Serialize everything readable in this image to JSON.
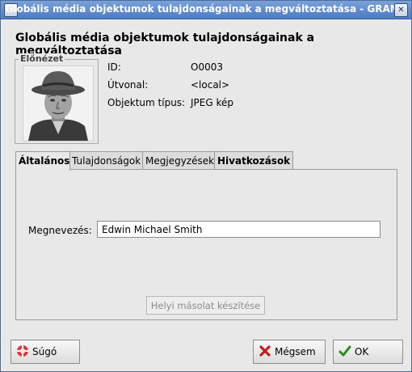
{
  "window": {
    "title": "Globális média objektumok tulajdonságainak a megváltoztatása - GRAMP",
    "menu_glyph": "⌄",
    "close_glyph": "✕"
  },
  "header": {
    "title": "Globális média objektumok tulajdonságainak a megváltoztatása"
  },
  "preview": {
    "label": "Előnézet"
  },
  "info": {
    "id_label": "ID:",
    "id_value": "O0003",
    "path_label": "Útvonal:",
    "path_value": "<local>",
    "type_label": "Objektum típus:",
    "type_value": "JPEG kép"
  },
  "tabs": [
    {
      "label": "Általános",
      "active": true
    },
    {
      "label": "Tulajdonságok",
      "active": false
    },
    {
      "label": "Megjegyzések",
      "active": false
    },
    {
      "label": "Hivatkozások",
      "active": false
    }
  ],
  "general": {
    "name_label": "Megnevezés:",
    "name_value": "Edwin Michael Smith",
    "local_copy_button": "Helyi másolat készítése"
  },
  "buttons": {
    "help": "Súgó",
    "cancel": "Mégsem",
    "ok": "OK"
  },
  "icons": {
    "help": "help-lifebuoy-icon",
    "cancel": "cancel-x-icon",
    "ok": "ok-checkmark-icon"
  },
  "colors": {
    "titlebar": "#5b87ca",
    "window_bg": "#e8e8e8"
  }
}
